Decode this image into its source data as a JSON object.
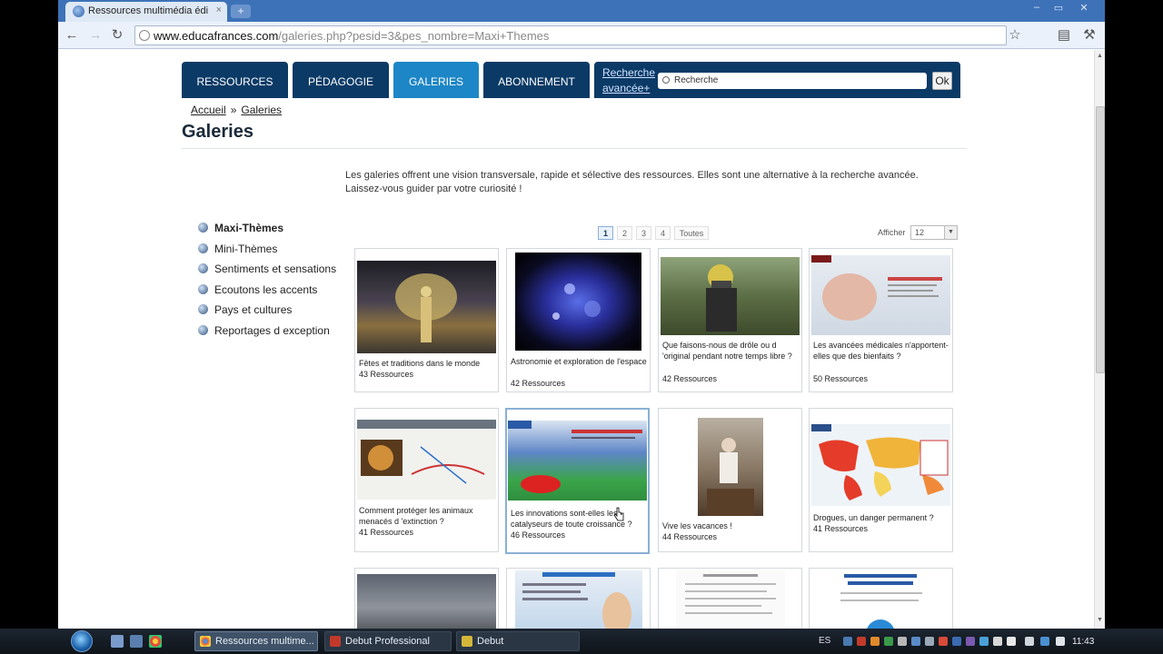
{
  "browser": {
    "tab_title": "Ressources multimédia édi",
    "tab_close": "×",
    "new_tab": "+",
    "url_host": "www.educafrances.com",
    "url_path": "/galeries.php?pesid=3&pes_nombre=Maxi+Themes",
    "buttons": {
      "back": "←",
      "forward": "→",
      "reload": "↻",
      "star": "☆",
      "page": "▤",
      "wrench": "⚒"
    },
    "window": {
      "minimize": "–",
      "maximize": "▭",
      "close": "✕"
    }
  },
  "site_nav": {
    "tabs": [
      "RESSOURCES",
      "PÉDAGOGIE",
      "GALERIES",
      "ABONNEMENT"
    ],
    "advanced_search": "Recherche avancée+",
    "search_placeholder": "Recherche",
    "ok": "Ok"
  },
  "breadcrumb": {
    "home": "Accueil",
    "separator": "»",
    "current": "Galeries"
  },
  "page_title": "Galeries",
  "intro": "Les galeries offrent une vision transversale, rapide et sélective des ressources. Elles sont une alternative à la recherche avancée. Laissez-vous guider par votre curiosité !",
  "left_menu": [
    "Maxi-Thèmes",
    "Mini-Thèmes",
    "Sentiments et sensations",
    "Ecoutons les accents",
    "Pays et cultures",
    "Reportages d exception"
  ],
  "pagination": {
    "pages": [
      "1",
      "2",
      "3",
      "4"
    ],
    "all": "Toutes",
    "show_label": "Afficher",
    "show_value": "12"
  },
  "gallery": [
    {
      "title": "Fêtes et traditions dans le monde",
      "count": "43 Ressources"
    },
    {
      "title": "Astronomie et exploration de l'espace",
      "count": "42 Ressources"
    },
    {
      "title": "Que faisons-nous de drôle ou d 'original pendant notre temps libre ?",
      "count": "42 Ressources"
    },
    {
      "title": "Les avancées médicales n'apportent-elles que des bienfaits ?",
      "count": "50 Ressources"
    },
    {
      "title": "Comment protéger les animaux menacés d 'extinction ?",
      "count": "41 Ressources"
    },
    {
      "title": "Les innovations sont-elles les catalyseurs de toute croissance ?",
      "count": "46 Ressources"
    },
    {
      "title": "Vive les vacances !",
      "count": "44 Ressources"
    },
    {
      "title": "Drogues, un danger permanent ?",
      "count": "41 Ressources"
    }
  ],
  "taskbar": {
    "buttons": [
      "Ressources multime...",
      "Debut Professional",
      "Debut"
    ],
    "language": "ES",
    "clock": "11:43"
  }
}
